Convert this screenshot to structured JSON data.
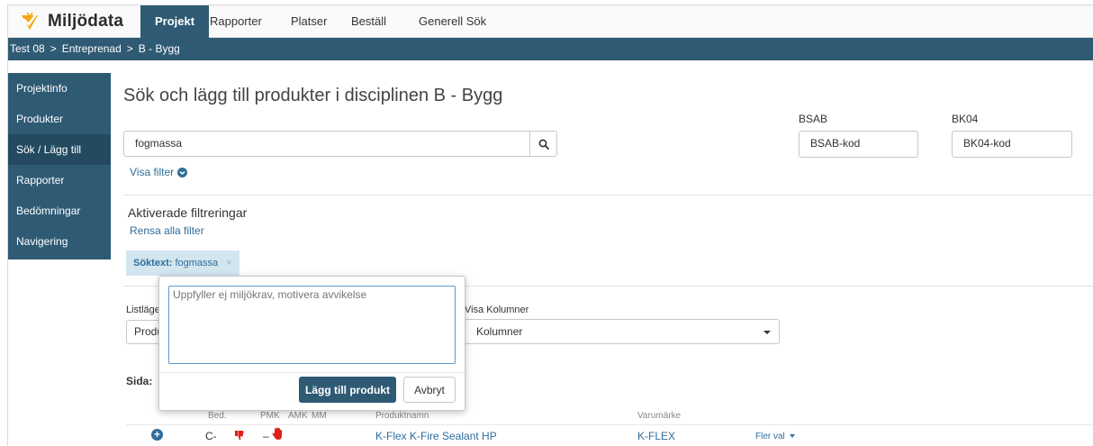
{
  "brand": {
    "name": "Miljödata"
  },
  "nav": {
    "items": [
      {
        "label": "Projekt",
        "active": true
      },
      {
        "label": "Rapporter"
      },
      {
        "label": "Platser"
      },
      {
        "label": "Beställ"
      },
      {
        "label": "Generell Sök"
      }
    ]
  },
  "breadcrumb": [
    "Test 08",
    "Entreprenad",
    "B - Bygg"
  ],
  "breadcrumb_sep": ">",
  "sidebar": {
    "items": [
      {
        "label": "Projektinfo"
      },
      {
        "label": "Produkter"
      },
      {
        "label": "Sök / Lägg till",
        "active": true
      },
      {
        "label": "Rapporter"
      },
      {
        "label": "Bedömningar"
      },
      {
        "label": "Navigering"
      }
    ]
  },
  "main": {
    "title": "Sök och lägg till produkter i disciplinen B - Bygg",
    "search_value": "fogmassa",
    "visa_filter": "Visa filter",
    "bsab_label": "BSAB",
    "bsab_placeholder": "BSAB-kod",
    "bk04_label": "BK04",
    "bk04_placeholder": "BK04-kod",
    "active_filters_title": "Aktiverade filtreringar",
    "clear_filters": "Rensa alla filter",
    "chip_label": "Söktext:",
    "chip_value": "fogmassa",
    "chip_close": "×",
    "listlage_label": "Listläge",
    "listlage_value": "Produkter",
    "visa_kolumner_label": "Visa Kolumner",
    "visa_kolumner_value": "Kolumner",
    "sida_label": "Sida:"
  },
  "table": {
    "headers": [
      "Bed.",
      "PMK",
      "AMK",
      "MM",
      "Produktnamn",
      "Varumärke"
    ],
    "row": {
      "bed": "C-",
      "pmk": "–",
      "product": "K-Flex K-Fire Sealant HP",
      "brand": "K-FLEX",
      "more": "Fler val"
    }
  },
  "modal": {
    "placeholder": "Uppfyller ej miljökrav, motivera avvikelse",
    "primary_label": "Lägg till produkt",
    "cancel_label": "Avbryt"
  },
  "colors": {
    "primary": "#2f5a74",
    "link": "#2f6d9b",
    "chip_bg": "#d3e6ef",
    "danger": "#e0201b",
    "brand_orange": "#f2a71b"
  }
}
